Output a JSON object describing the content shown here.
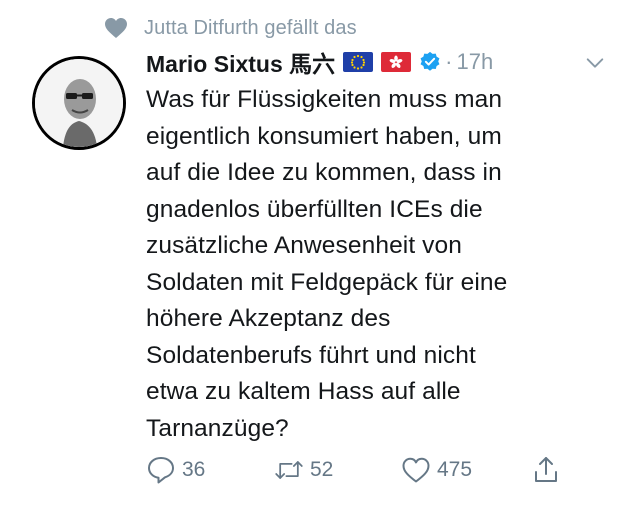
{
  "social_context": {
    "text": "Jutta Ditfurth gefällt das",
    "icon": "heart-icon"
  },
  "tweet": {
    "author_name": "Mario Sixtus 馬六",
    "flags": [
      "eu-flag",
      "hong-kong-flag"
    ],
    "verified": true,
    "separator": "·",
    "timestamp": "17h",
    "text": "Was für Flüssigkeiten muss man\neigentlich konsumiert haben, um\nauf die Idee zu kommen, dass in\ngnadenlos überfüllten ICEs die\nzusätzliche Anwesenheit von\nSoldaten mit Feldgepäck für eine\nhöhere Akzeptanz des\nSoldatenberufs führt und nicht\netwa zu kaltem Hass auf alle\nTarnanzüge?"
  },
  "actions": {
    "reply_count": "36",
    "retweet_count": "52",
    "like_count": "475"
  },
  "colors": {
    "muted": "#8899a6",
    "text": "#14171a",
    "verified": "#1da1f2"
  }
}
